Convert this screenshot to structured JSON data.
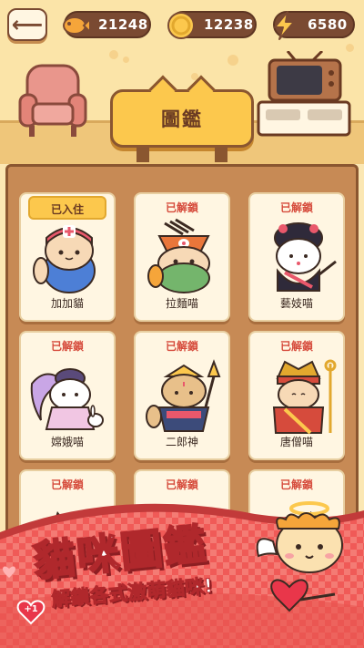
{
  "header": {
    "back_icon": "back-arrow-icon",
    "fish": {
      "icon": "fish-cracker-icon",
      "value": "21248"
    },
    "coin": {
      "icon": "gold-coin-icon",
      "value": "12238"
    },
    "energy": {
      "icon": "lightning-bolt-icon",
      "value": "6580"
    }
  },
  "title_sign": {
    "text": "圖鑑"
  },
  "cards": [
    {
      "status": "已入住",
      "name": "加加貓",
      "art": "nurse-cat-art"
    },
    {
      "status": "已解鎖",
      "name": "拉麵喵",
      "art": "ramen-cat-art"
    },
    {
      "status": "已解鎖",
      "name": "藝妓喵",
      "art": "geisha-cat-art"
    },
    {
      "status": "已解鎖",
      "name": "嫦娥喵",
      "art": "change-cat-art"
    },
    {
      "status": "已解鎖",
      "name": "二郎神",
      "art": "erlang-cat-art"
    },
    {
      "status": "已解鎖",
      "name": "唐僧喵",
      "art": "monk-cat-art"
    },
    {
      "status": "已解鎖",
      "name": "",
      "art": "green-cat-art"
    },
    {
      "status": "已解鎖",
      "name": "",
      "art": "brown-cat-art"
    },
    {
      "status": "已解鎖",
      "name": "",
      "art": "grey-cat-art"
    }
  ],
  "banner": {
    "title": "貓咪圖鑑",
    "subtitle": "解鎖各式激萌貓咪!",
    "badge": "+1"
  },
  "colors": {
    "accent_yellow": "#fcc84d",
    "wood": "#c78a55",
    "status_red": "#d64b3c",
    "banner_red": "#e8534f"
  }
}
